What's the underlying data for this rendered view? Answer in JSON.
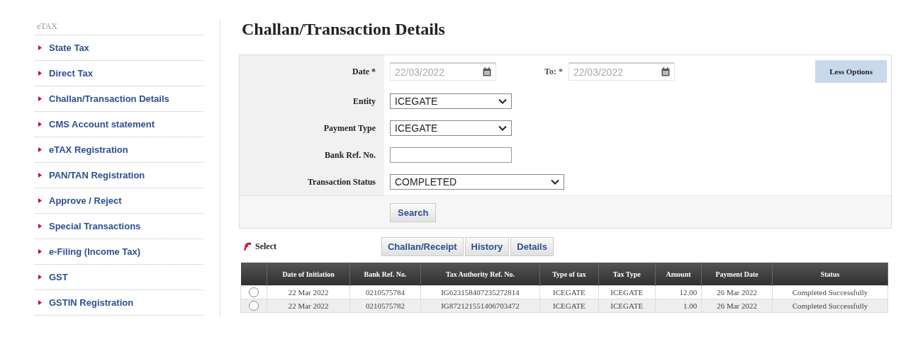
{
  "sidebar": {
    "heading": "eTAX",
    "items": [
      {
        "label": "State Tax"
      },
      {
        "label": "Direct Tax"
      },
      {
        "label": "Challan/Transaction Details"
      },
      {
        "label": "CMS Account statement"
      },
      {
        "label": "eTAX Registration"
      },
      {
        "label": "PAN/TAN Registration"
      },
      {
        "label": "Approve / Reject"
      },
      {
        "label": "Special Transactions"
      },
      {
        "label": "e-Filing (Income Tax)"
      },
      {
        "label": "GST"
      },
      {
        "label": "GSTIN Registration"
      }
    ]
  },
  "title": "Challan/Transaction Details",
  "form": {
    "date_label": "Date *",
    "date_value": "22/03/2022",
    "to_label": "To: *",
    "to_value": "22/03/2022",
    "less_options": "Less Options",
    "fields": [
      {
        "kind": "select",
        "label": "Entity",
        "value": "ICEGATE"
      },
      {
        "kind": "select",
        "label": "Payment Type",
        "value": "ICEGATE"
      },
      {
        "kind": "text",
        "label": "Bank Ref. No."
      },
      {
        "kind": "wideselect",
        "label": "Transaction Status",
        "value": "COMPLETED"
      }
    ],
    "search": "Search"
  },
  "select_label": "Select",
  "actions": [
    "Challan/Receipt",
    "History",
    "Details"
  ],
  "table": {
    "columns": [
      "Date of Initiation",
      "Bank Ref. No.",
      "Tax Authority Ref. No.",
      "Type of tax",
      "Tax Type",
      "Amount",
      "Payment Date",
      "Status"
    ],
    "rows": [
      {
        "selected": false,
        "cells": [
          "22 Mar 2022",
          "0210575784",
          "IG623158407235272814",
          "ICEGATE",
          "ICEGATE",
          "12.00",
          "26 Mar 2022",
          "Completed Successfully"
        ]
      },
      {
        "selected": false,
        "cells": [
          "22 Mar 2022",
          "0210575782",
          "IG872121551406703472",
          "ICEGATE",
          "ICEGATE",
          "1.00",
          "26 Mar 2022",
          "Completed Successfully"
        ]
      }
    ]
  }
}
